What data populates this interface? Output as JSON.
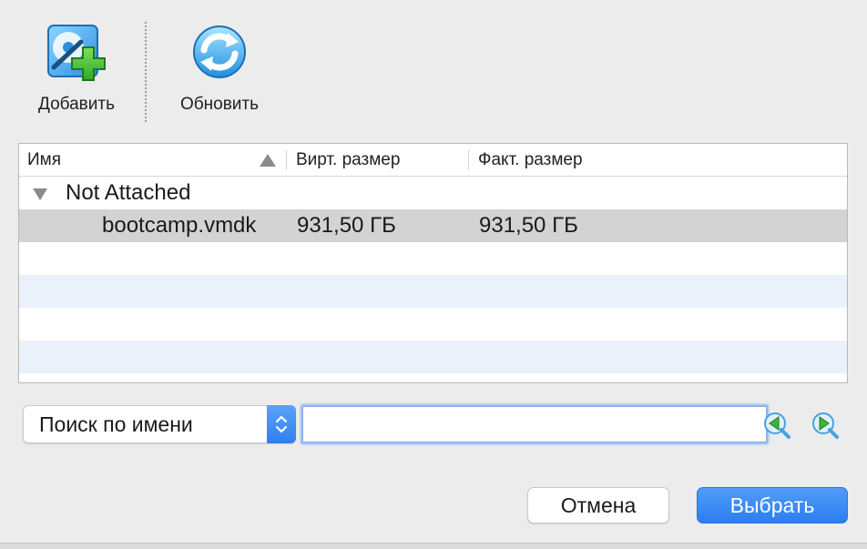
{
  "toolbar": {
    "add_label": "Добавить",
    "refresh_label": "Обновить"
  },
  "table": {
    "columns": [
      "Имя",
      "Вирт. размер",
      "Факт. размер"
    ],
    "group": "Not Attached",
    "rows": [
      {
        "name": "bootcamp.vmdk",
        "virtual_size": "931,50 ГБ",
        "actual_size": "931,50 ГБ"
      }
    ]
  },
  "search": {
    "mode": "Поиск по имени",
    "value": ""
  },
  "dialog": {
    "cancel_label": "Отмена",
    "choose_label": "Выбрать"
  },
  "colors": {
    "accent": "#2f7ff0",
    "selection": "#d3d3d3",
    "alt_row": "#eaf1fb"
  }
}
